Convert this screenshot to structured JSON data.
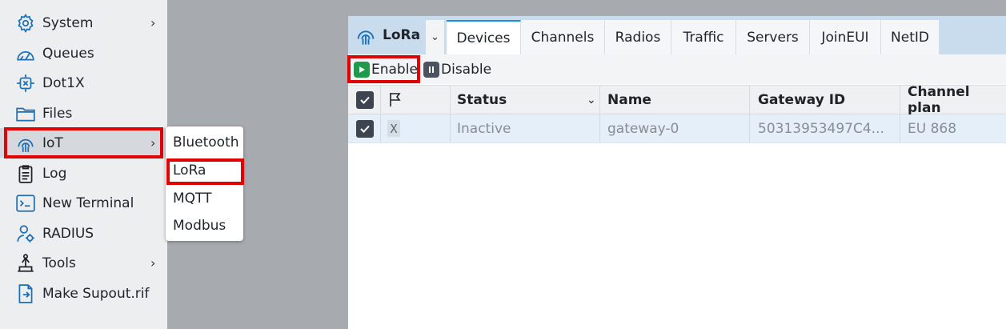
{
  "sidebar": {
    "items": [
      {
        "label": "System",
        "icon": "gear-icon",
        "has_submenu": true
      },
      {
        "label": "Queues",
        "icon": "gauge-icon",
        "has_submenu": false
      },
      {
        "label": "Dot1X",
        "icon": "network-x-icon",
        "has_submenu": false
      },
      {
        "label": "Files",
        "icon": "folder-icon",
        "has_submenu": false
      },
      {
        "label": "IoT",
        "icon": "iot-antenna-icon",
        "has_submenu": true
      },
      {
        "label": "Log",
        "icon": "clipboard-list-icon",
        "has_submenu": false
      },
      {
        "label": "New Terminal",
        "icon": "terminal-icon",
        "has_submenu": false
      },
      {
        "label": "RADIUS",
        "icon": "user-gear-icon",
        "has_submenu": false
      },
      {
        "label": "Tools",
        "icon": "tools-icon",
        "has_submenu": true
      },
      {
        "label": "Make Supout.rif",
        "icon": "file-arrow-icon",
        "has_submenu": false
      }
    ],
    "chevron": "›"
  },
  "submenu": {
    "items": [
      "Bluetooth",
      "LoRa",
      "MQTT",
      "Modbus"
    ]
  },
  "window": {
    "title": "LoRa",
    "dropdown_glyph": "⌄",
    "tabs": [
      "Devices",
      "Channels",
      "Radios",
      "Traffic",
      "Servers",
      "JoinEUI",
      "NetID"
    ],
    "active_tab": "Devices",
    "toolbar": {
      "enable_label": "Enable",
      "disable_label": "Disable"
    },
    "table": {
      "columns": [
        "Status",
        "Name",
        "Gateway ID",
        "Channel plan"
      ],
      "sort_glyph": "⌄",
      "rows": [
        {
          "flag": "X",
          "status": "Inactive",
          "name": "gateway-0",
          "gateway_id": "50313953497C4...",
          "channel_plan": "EU 868"
        }
      ]
    }
  },
  "colors": {
    "highlight": "#e00000",
    "enable_green": "#1f9a4a",
    "disable_gray": "#4a5360",
    "active_tab_border": "#1d8fe0",
    "selected_row": "#e4eff9"
  }
}
